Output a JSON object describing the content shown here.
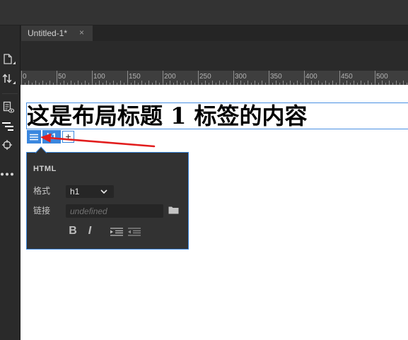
{
  "colors": {
    "accent_blue": "#3a87df",
    "heading_outline": "#4a90e2",
    "annotation_red": "#e21d1d"
  },
  "left_toolbar": {
    "icons": [
      "file-icon",
      "up-down-arrows-icon",
      "document-preview-icon",
      "indented-list-icon",
      "crosshair-icon",
      "more-dots-icon"
    ],
    "active": "indented-list-icon"
  },
  "document_tabs": [
    {
      "title": "Untitled-1*",
      "close_glyph": "×"
    }
  ],
  "ruler": {
    "labels": [
      "0",
      "50",
      "100",
      "150",
      "200",
      "250",
      "300",
      "350",
      "400",
      "450",
      "500"
    ]
  },
  "design_view": {
    "heading_text": "这是布局标题 1 标签的内容"
  },
  "element_hud": {
    "menu_icon": "hamburger-icon",
    "tag_label": "h1",
    "add_glyph": "+"
  },
  "property_inspector": {
    "title": "HTML",
    "format": {
      "label": "格式",
      "value": "h1",
      "dropdown_icon": "chevron-down-icon"
    },
    "link": {
      "label": "链接",
      "placeholder": "undefined",
      "browse_icon": "folder-icon"
    },
    "bold_label": "B",
    "italic_label": "I",
    "indent_icon": "indent-icon",
    "outdent_icon": "outdent-icon"
  }
}
